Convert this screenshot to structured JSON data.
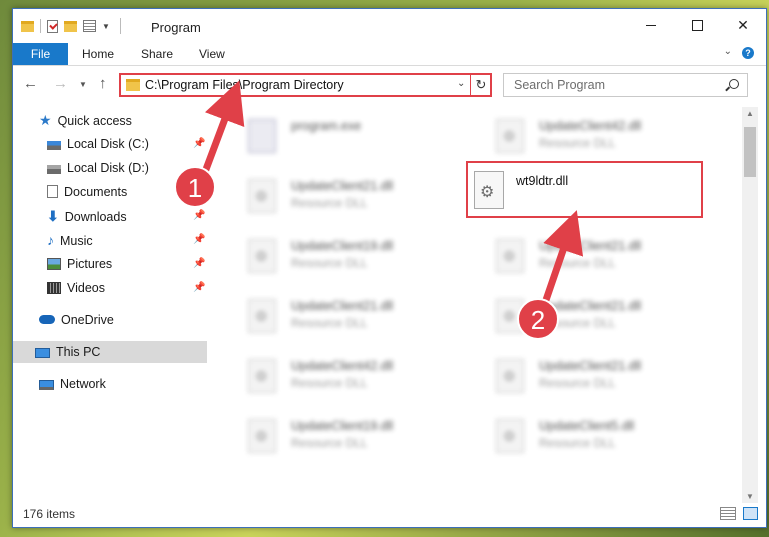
{
  "window": {
    "title": "Program",
    "controls": {
      "minimize": "—",
      "maximize": "☐",
      "close": "✕"
    }
  },
  "ribbon": {
    "tabs": [
      "File",
      "Home",
      "Share",
      "View"
    ]
  },
  "navigation": {
    "address": "C:\\Program Files\\Program Directory",
    "search_placeholder": "Search Program"
  },
  "sidebar": {
    "items": [
      {
        "label": "Quick access",
        "icon": "star-icon",
        "pinned": false
      },
      {
        "label": "Local Disk (C:)",
        "icon": "drive-icon",
        "pinned": true
      },
      {
        "label": "Local Disk (D:)",
        "icon": "drive-icon",
        "pinned": false
      },
      {
        "label": "Documents",
        "icon": "documents-icon",
        "pinned": true
      },
      {
        "label": "Downloads",
        "icon": "downloads-icon",
        "pinned": true
      },
      {
        "label": "Music",
        "icon": "music-icon",
        "pinned": true
      },
      {
        "label": "Pictures",
        "icon": "pictures-icon",
        "pinned": true
      },
      {
        "label": "Videos",
        "icon": "videos-icon",
        "pinned": true
      },
      {
        "label": "OneDrive",
        "icon": "onedrive-icon",
        "pinned": false
      },
      {
        "label": "This PC",
        "icon": "this-pc-icon",
        "pinned": false,
        "selected": true
      },
      {
        "label": "Network",
        "icon": "network-icon",
        "pinned": false
      }
    ]
  },
  "files": {
    "items": [
      {
        "name": "program.exe",
        "type": ""
      },
      {
        "name": "UpdateClient42.dll",
        "type": "Resource DLL"
      },
      {
        "name": "UpdateClient21.dll",
        "type": "Resource DLL"
      },
      {
        "name": "UpdateClient19.dll",
        "type": "Resource DLL"
      },
      {
        "name": "UpdateClient21.dll",
        "type": "Resource DLL"
      },
      {
        "name": "UpdateClient21.dll",
        "type": "Resource DLL"
      },
      {
        "name": "UpdateClient21.dll",
        "type": "Resource DLL"
      },
      {
        "name": "UpdateClient42.dll",
        "type": "Resource DLL"
      },
      {
        "name": "UpdateClient21.dll",
        "type": "Resource DLL"
      },
      {
        "name": "UpdateClient19.dll",
        "type": "Resource DLL"
      },
      {
        "name": "UpdateClient5.dll",
        "type": "Resource DLL"
      }
    ],
    "highlighted": {
      "name": "wt9ldtr.dll"
    }
  },
  "status": {
    "item_count": "176 items"
  },
  "annotations": {
    "step1": "1",
    "step2": "2",
    "color": "#e04048"
  }
}
